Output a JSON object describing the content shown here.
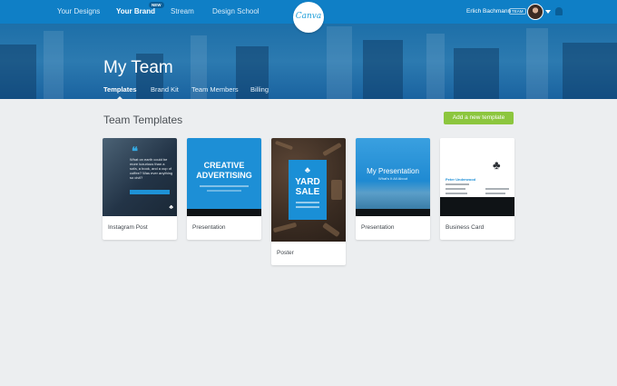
{
  "nav": {
    "links": [
      "Your Designs",
      "Your Brand",
      "Stream",
      "Design School"
    ],
    "new_badge": "NEW",
    "logo": "Canva",
    "user_name": "Erlich Bachmann",
    "team_badge": "TEAM"
  },
  "hero": {
    "title": "My Team",
    "tabs": [
      "Templates",
      "Brand Kit",
      "Team Members",
      "Billing"
    ],
    "active_tab": "Templates"
  },
  "section": {
    "title": "Team Templates",
    "add_button": "Add a new template"
  },
  "templates": [
    {
      "label": "Instagram Post",
      "thumb_text": "What on earth could be more luxurious than a sofa, a book, and a cup of coffee? Was ever anything so civil?"
    },
    {
      "label": "Presentation",
      "thumb_title": "CREATIVE ADVERTISING"
    },
    {
      "label": "Poster",
      "thumb_title": "YARD SALE"
    },
    {
      "label": "Presentation",
      "thumb_title": "My Presentation",
      "thumb_subtitle": "What's It All About"
    },
    {
      "label": "Business Card",
      "thumb_name": "Peter Underwood"
    }
  ],
  "icons": {
    "avatar": "user-avatar",
    "notifications": "bell-icon",
    "dropdown": "caret-down-icon",
    "leaf": "leaf-logo-icon"
  },
  "colors": {
    "nav_blue": "#0f7fc6",
    "accent_green": "#8cc63e",
    "canva_blue": "#1d9ed9"
  }
}
